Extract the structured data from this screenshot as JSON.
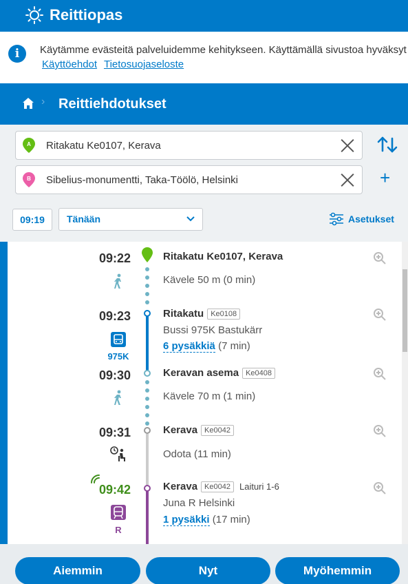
{
  "app": {
    "title": "Reittiopas"
  },
  "cookie": {
    "text": "Käytämme evästeitä palveluidemme kehitykseen. Käyttämällä sivustoa hyväksyt evästeiden käytön.",
    "link1": "Käyttöehdot",
    "link2": "Tietosuojaseloste"
  },
  "nav": {
    "crumb": "Reittiehdotukset"
  },
  "form": {
    "from": "Ritakatu Ke0107, Kerava",
    "to": "Sibelius-monumentti, Taka-Töölö, Helsinki",
    "from_badge": "A",
    "to_badge": "B",
    "time": "09:19",
    "date": "Tänään",
    "settings_label": "Asetukset"
  },
  "colors": {
    "brand": "#007ac9",
    "walk": "#6eb3c5",
    "train": "#8c4799",
    "realtime": "#3f8e1b",
    "wait": "#cccccc",
    "origin": "#64be14",
    "destination": "#ec5fa8"
  },
  "legs": [
    {
      "time": "09:22",
      "stop": "Ritakatu Ke0107, Kerava",
      "desc": "Kävele 50 m (0 min)",
      "mode": "walk"
    },
    {
      "time": "09:23",
      "stop": "Ritakatu",
      "code": "Ke0108",
      "desc": "Bussi 975K Bastukärr",
      "link": "6 pysäkkiä",
      "suffix": " (7 min)",
      "mode": "bus",
      "route": "975K"
    },
    {
      "time": "09:30",
      "stop": "Keravan asema",
      "code": "Ke0408",
      "desc": "Kävele 70 m (1 min)",
      "mode": "walk"
    },
    {
      "time": "09:31",
      "stop": "Kerava",
      "code": "Ke0042",
      "desc": "Odota (11 min)",
      "mode": "wait"
    },
    {
      "time": "09:42",
      "stop": "Kerava",
      "code": "Ke0042",
      "platform": "Laituri 1-6",
      "desc": "Juna R Helsinki",
      "link": "1 pysäkki",
      "suffix": " (17 min)",
      "mode": "rail",
      "route": "R"
    }
  ],
  "footer": {
    "earlier": "Aiemmin",
    "now": "Nyt",
    "later": "Myöhemmin"
  }
}
